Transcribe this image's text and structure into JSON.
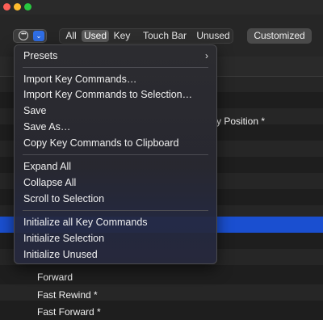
{
  "toolbar": {
    "options_dots": "•••",
    "options_chevron": "⌄",
    "filters": [
      {
        "label": "All",
        "active": false
      },
      {
        "label": "Used",
        "active": true
      },
      {
        "label": "Key",
        "active": false
      },
      {
        "label": "Touch Bar",
        "active": false
      },
      {
        "label": "Unused",
        "active": false
      }
    ],
    "customized_label": "Customized"
  },
  "menu": {
    "presets_label": "Presets",
    "presets_arrow": "›",
    "group1": [
      "Import Key Commands…",
      "Import Key Commands to Selection…",
      "Save",
      "Save As…",
      "Copy Key Commands to Clipboard"
    ],
    "group2": [
      "Expand All",
      "Collapse All",
      "Scroll to Selection"
    ],
    "group3": [
      "Initialize all Key Commands",
      "Initialize Selection",
      "Initialize Unused"
    ]
  },
  "table": {
    "partial_text": "y Position *",
    "rows": [
      "Forward",
      "Fast Rewind *",
      "Fast Forward *"
    ]
  },
  "colors": {
    "accent": "#2f6ee6",
    "selection": "#1a4fd0",
    "menu_background": "#2c2c30"
  }
}
